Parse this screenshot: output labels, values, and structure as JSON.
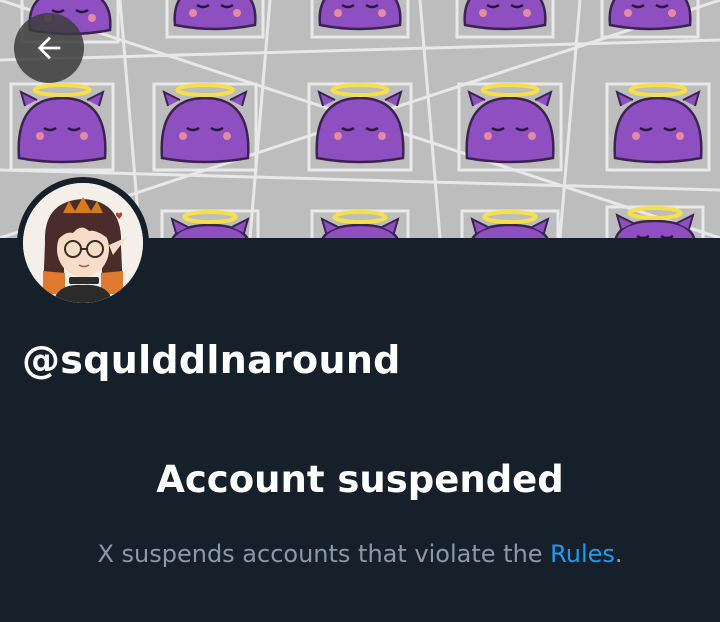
{
  "profile": {
    "handle": "@squlddlnaround"
  },
  "banner": {
    "description_icon": "purple-blob-halo-pattern"
  },
  "nav": {
    "back_icon": "arrow-left-icon"
  },
  "suspension": {
    "title": "Account suspended",
    "message_prefix": "X suspends accounts that violate the ",
    "rules_link": "Rules",
    "message_suffix": "."
  },
  "colors": {
    "background": "#15202b",
    "link": "#1d9bf0",
    "muted_text": "#8b98a5",
    "blob_purple": "#8e4fc0",
    "halo_yellow": "#f5e04a"
  }
}
